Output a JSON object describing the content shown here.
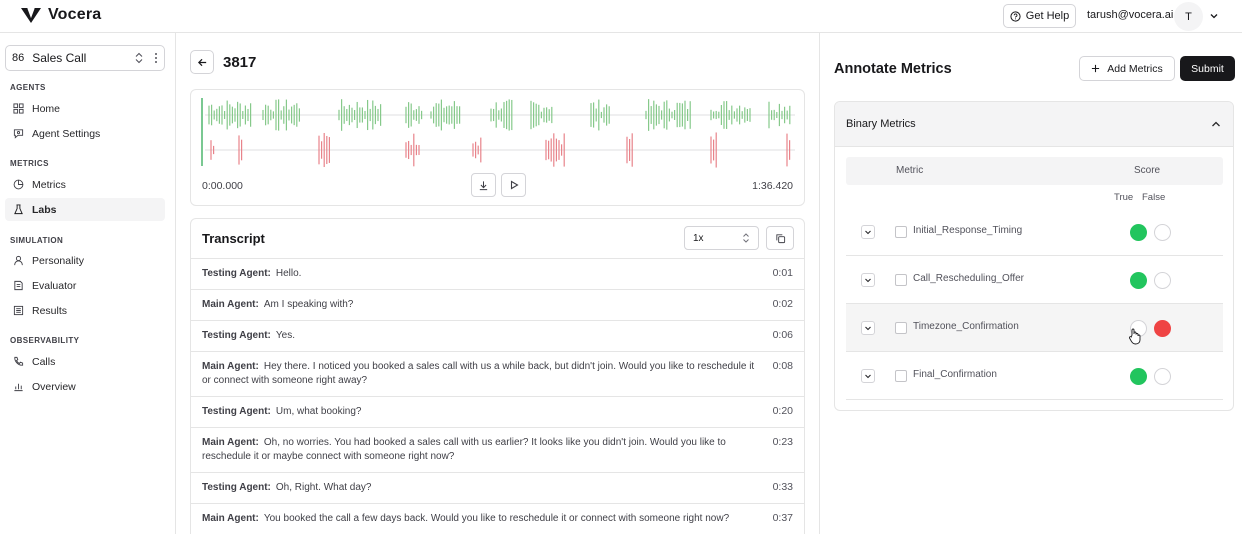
{
  "header": {
    "brand": "Vocera",
    "help_label": "Get Help",
    "user_email": "tarush@vocera.ai",
    "avatar_initial": "T"
  },
  "sidebar": {
    "agent_number": "86",
    "agent_name": "Sales Call",
    "sections": [
      {
        "title": "AGENTS",
        "items": [
          {
            "label": "Home",
            "icon": "grid-icon"
          },
          {
            "label": "Agent Settings",
            "icon": "chat-settings-icon"
          }
        ]
      },
      {
        "title": "METRICS",
        "items": [
          {
            "label": "Metrics",
            "icon": "pie-chart-icon"
          },
          {
            "label": "Labs",
            "icon": "flask-icon",
            "active": true
          }
        ]
      },
      {
        "title": "SIMULATION",
        "items": [
          {
            "label": "Personality",
            "icon": "person-icon"
          },
          {
            "label": "Evaluator",
            "icon": "document-icon"
          },
          {
            "label": "Results",
            "icon": "list-icon"
          }
        ]
      },
      {
        "title": "OBSERVABILITY",
        "items": [
          {
            "label": "Calls",
            "icon": "phone-icon"
          },
          {
            "label": "Overview",
            "icon": "bar-chart-icon"
          }
        ]
      }
    ]
  },
  "call": {
    "id": "3817",
    "time_start": "0:00.000",
    "time_end": "1:36.420"
  },
  "transcript": {
    "title": "Transcript",
    "speed": "1x",
    "rows": [
      {
        "speaker": "Testing Agent:",
        "text": "Hello.",
        "time": "0:01"
      },
      {
        "speaker": "Main Agent:",
        "text": "Am I speaking with?",
        "time": "0:02"
      },
      {
        "speaker": "Testing Agent:",
        "text": "Yes.",
        "time": "0:06"
      },
      {
        "speaker": "Main Agent:",
        "text": "Hey there. I noticed you booked a sales call with us a while back, but didn't join. Would you like to reschedule it or connect with someone right away?",
        "time": "0:08"
      },
      {
        "speaker": "Testing Agent:",
        "text": "Um, what booking?",
        "time": "0:20"
      },
      {
        "speaker": "Main Agent:",
        "text": "Oh, no worries. You had booked a sales call with us earlier? It looks like you didn't join. Would you like to reschedule it or maybe connect with someone right now?",
        "time": "0:23"
      },
      {
        "speaker": "Testing Agent:",
        "text": "Oh, Right. What day?",
        "time": "0:33"
      },
      {
        "speaker": "Main Agent:",
        "text": "You booked the call a few days back. Would you like to reschedule it or connect with someone right now?",
        "time": "0:37"
      }
    ]
  },
  "annotate": {
    "title": "Annotate Metrics",
    "add_label": "Add Metrics",
    "submit_label": "Submit",
    "section_title": "Binary Metrics",
    "col_metric": "Metric",
    "col_score": "Score",
    "label_true": "True",
    "label_false": "False",
    "metrics": [
      {
        "name": "Initial_Response_Timing",
        "value": "true"
      },
      {
        "name": "Call_Rescheduling_Offer",
        "value": "true"
      },
      {
        "name": "Timezone_Confirmation",
        "value": "false"
      },
      {
        "name": "Final_Confirmation",
        "value": "true"
      }
    ]
  },
  "colors": {
    "accent_dark": "#18181b",
    "wave_testing": "#86c98a",
    "wave_main": "#e8838a",
    "true_green": "#22c55e",
    "false_red": "#ef4444"
  }
}
